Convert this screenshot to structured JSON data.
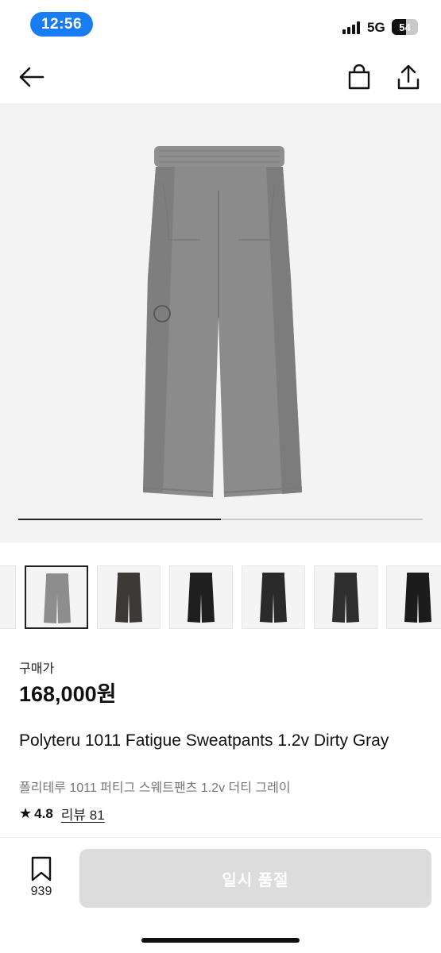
{
  "status_bar": {
    "time": "12:56",
    "network": "5G",
    "battery": "54",
    "battery_level_percent": 54
  },
  "nav": {
    "back_icon": "arrow-left-icon",
    "bag_icon": "shopping-bag-icon",
    "share_icon": "share-icon"
  },
  "gallery": {
    "progress_fraction": 0.5,
    "main_color": "#8a8a8a"
  },
  "thumbnails": [
    {
      "color": "#8d8d8d",
      "selected": true
    },
    {
      "color": "#3b3a36",
      "selected": false
    },
    {
      "color": "#1f1f1f",
      "selected": false
    },
    {
      "color": "#2a2a2a",
      "selected": false
    },
    {
      "color": "#2e2e2e",
      "selected": false
    },
    {
      "color": "#1c1c1c",
      "selected": false
    }
  ],
  "product": {
    "price_label": "구매가",
    "price": "168,000원",
    "title_en": "Polyteru 1011 Fatigue Sweatpants 1.2v Dirty Gray",
    "title_ko": "폴리테루 1011 퍼티그 스웨트팬츠 1.2v 더티 그레이",
    "rating": "4.8",
    "reviews": "리뷰 81"
  },
  "bottom_bar": {
    "bookmark_count": "939",
    "button_label": "일시 품절"
  }
}
